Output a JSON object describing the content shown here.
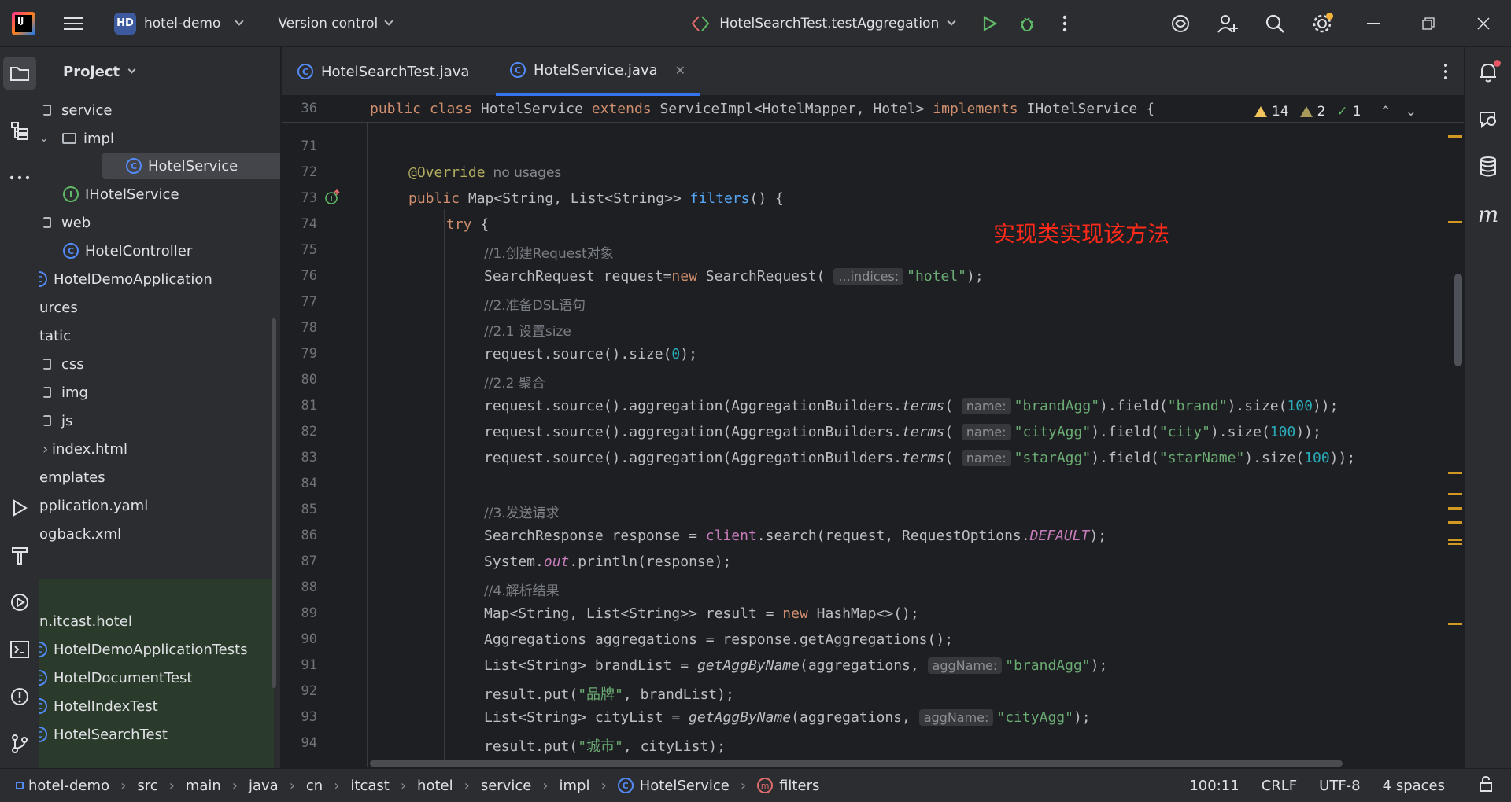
{
  "titlebar": {
    "logo_text": "IJ",
    "project_badge": "HD",
    "project_name": "hotel-demo",
    "version_control": "Version control",
    "run_config": "HotelSearchTest.testAggregation"
  },
  "left_strip": {
    "items": [
      "folder-icon",
      "structure-icon",
      "more-icon",
      "run-icon",
      "build-icon",
      "services-icon",
      "terminal-icon",
      "problems-icon",
      "git-icon"
    ]
  },
  "project_panel": {
    "title": "Project",
    "rows": [
      {
        "label": "service",
        "type": "folder"
      },
      {
        "label": "impl",
        "type": "folder"
      },
      {
        "label": "HotelService",
        "type": "class",
        "selected": true
      },
      {
        "label": "IHotelService",
        "type": "interface"
      },
      {
        "label": "web",
        "type": "folder"
      },
      {
        "label": "HotelController",
        "type": "class"
      },
      {
        "label": "HotelDemoApplication",
        "type": "class"
      },
      {
        "label": "urces",
        "type": "text"
      },
      {
        "label": "tatic",
        "type": "text"
      },
      {
        "label": "css",
        "type": "folder"
      },
      {
        "label": "img",
        "type": "folder"
      },
      {
        "label": "js",
        "type": "folder"
      },
      {
        "label": "index.html",
        "type": "file"
      },
      {
        "label": "emplates",
        "type": "text"
      },
      {
        "label": "pplication.yaml",
        "type": "text"
      },
      {
        "label": "ogback.xml",
        "type": "text"
      },
      {
        "label": "n.itcast.hotel",
        "type": "text"
      },
      {
        "label": "HotelDemoApplicationTests",
        "type": "test"
      },
      {
        "label": "HotelDocumentTest",
        "type": "test"
      },
      {
        "label": "HotelIndexTest",
        "type": "test"
      },
      {
        "label": "HotelSearchTest",
        "type": "test"
      }
    ]
  },
  "tabs": [
    {
      "label": "HotelSearchTest.java",
      "active": false
    },
    {
      "label": "HotelService.java",
      "active": true
    }
  ],
  "editor": {
    "sticky_line_num": "36",
    "sticky_parts": {
      "a": "public class ",
      "b": "HotelService ",
      "c": "extends ",
      "d": "ServiceImpl<HotelMapper, Hotel> ",
      "e": "implements ",
      "f": "IHotelService {"
    },
    "inspections": {
      "warnings": "14",
      "weak_warnings": "2",
      "ok": "1"
    },
    "annotation_text": "实现类实现该方法",
    "lines": {
      "n71": "71",
      "n72": "72",
      "n73": "73",
      "n74": "74",
      "n75": "75",
      "n76": "76",
      "n77": "77",
      "n78": "78",
      "n79": "79",
      "n80": "80",
      "n81": "81",
      "n82": "82",
      "n83": "83",
      "n84": "84",
      "n85": "85",
      "n86": "86",
      "n87": "87",
      "n88": "88",
      "n89": "89",
      "n90": "90",
      "n91": "91",
      "n92": "92",
      "n93": "93",
      "n94": "94"
    },
    "code": {
      "l72_ann": "@Override",
      "l72_usage": "no usages",
      "l73_a": "public ",
      "l73_b": "Map<String, List<String>> ",
      "l73_c": "filters",
      "l73_d": "() {",
      "l74_a": "try ",
      "l74_b": "{",
      "l75": "//1.创建Request对象",
      "l76_a": "SearchRequest request=",
      "l76_b": "new ",
      "l76_c": "SearchRequest(",
      "l76_hint": "...indices:",
      "l76_d": "\"hotel\"",
      "l76_e": ");",
      "l77": "//2.准备DSL语句",
      "l78": "//2.1 设置size",
      "l79_a": "request.source().size(",
      "l79_b": "0",
      "l79_c": ");",
      "l80": "//2.2 聚合",
      "l81_a": "request.source().aggregation(AggregationBuilders.",
      "l81_b": "terms",
      "l81_c": "(",
      "l81_hint": "name:",
      "l81_d": "\"brandAgg\"",
      "l81_e": ").field(",
      "l81_f": "\"brand\"",
      "l81_g": ").size(",
      "l81_h": "100",
      "l81_i": "));",
      "l82_d": "\"cityAgg\"",
      "l82_f": "\"city\"",
      "l83_d": "\"starAgg\"",
      "l83_f": "\"starName\"",
      "l85": "//3.发送请求",
      "l86_a": "SearchResponse response = ",
      "l86_b": "client",
      "l86_c": ".search(request, RequestOptions.",
      "l86_d": "DEFAULT",
      "l86_e": ");",
      "l87_a": "System.",
      "l87_b": "out",
      "l87_c": ".println(response);",
      "l88": "//4.解析结果",
      "l89_a": "Map<String, List<String>> result = ",
      "l89_b": "new ",
      "l89_c": "HashMap<>();",
      "l90": "Aggregations aggregations = response.getAggregations();",
      "l91_a": "List<String> brandList = ",
      "l91_b": "getAggByName",
      "l91_c": "(aggregations,",
      "l91_hint": "aggName:",
      "l91_d": "\"brandAgg\"",
      "l91_e": ");",
      "l92_a": "result.put(",
      "l92_b": "\"品牌\"",
      "l92_c": ", brandList);",
      "l93_a": "List<String> cityList = ",
      "l93_b": "getAggByName",
      "l93_c": "(aggregations,",
      "l93_hint": "aggName:",
      "l93_d": "\"cityAgg\"",
      "l93_e": ");",
      "l94_a": "result.put(",
      "l94_b": "\"城市\"",
      "l94_c": ", cityList);"
    }
  },
  "right_strip": {
    "items": [
      "notifications-icon",
      "ai-assistant-icon",
      "database-icon",
      "maven-icon"
    ]
  },
  "statusbar": {
    "crumbs": [
      "hotel-demo",
      "src",
      "main",
      "java",
      "cn",
      "itcast",
      "hotel",
      "service",
      "impl",
      "HotelService",
      "filters"
    ],
    "position": "100:11",
    "line_sep": "CRLF",
    "encoding": "UTF-8",
    "indent": "4 spaces"
  }
}
